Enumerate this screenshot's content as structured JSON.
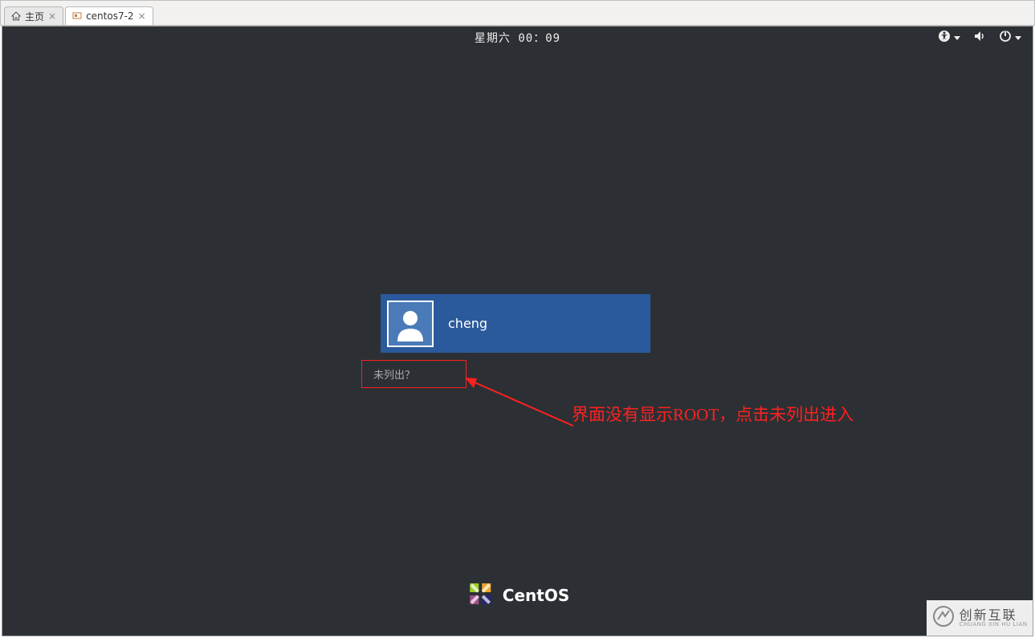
{
  "vmware": {
    "tabs": [
      {
        "label": "主页",
        "icon": "home"
      },
      {
        "label": "centos7-2",
        "icon": "vm"
      }
    ]
  },
  "gnome": {
    "clock": "星期六 00：09",
    "status": {
      "accessibility": "accessibility-icon",
      "sound": "sound-icon",
      "power": "power-icon"
    }
  },
  "login": {
    "user_name": "cheng",
    "not_listed_label": "未列出？"
  },
  "annotation": {
    "text": "界面没有显示ROOT，点击未列出进入"
  },
  "branding": {
    "os_name": "CentOS"
  },
  "watermark": {
    "zh": "创新互联",
    "en": "CHUANG XIN HU LIAN"
  }
}
